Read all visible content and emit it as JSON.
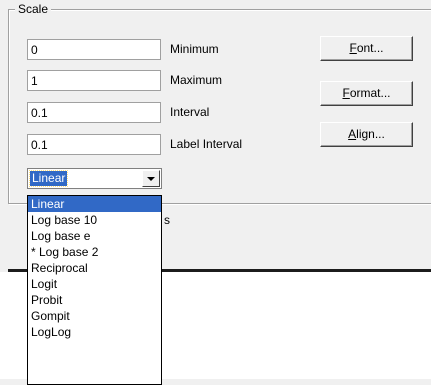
{
  "scale": {
    "group_label": "Scale",
    "fields": [
      {
        "value": "0",
        "label": "Minimum"
      },
      {
        "value": "1",
        "label": "Maximum"
      },
      {
        "value": "0.1",
        "label": "Interval"
      },
      {
        "value": "0.1",
        "label": "Label Interval"
      }
    ],
    "buttons": {
      "font": {
        "accel": "F",
        "rest": "ont..."
      },
      "format": {
        "accel": "F",
        "rest": "ormat..."
      },
      "align": {
        "accel": "A",
        "rest": "lign..."
      }
    },
    "scale_type": {
      "selected": "Linear",
      "options": [
        "Linear",
        "Log base 10",
        "Log base e",
        "* Log base 2",
        "Reciprocal",
        "Logit",
        "Probit",
        "Gompit",
        "LogLog"
      ]
    },
    "obscured_label_fragment": "s"
  },
  "colors": {
    "selection": "#3169c6",
    "background": "#f0f0f0"
  }
}
